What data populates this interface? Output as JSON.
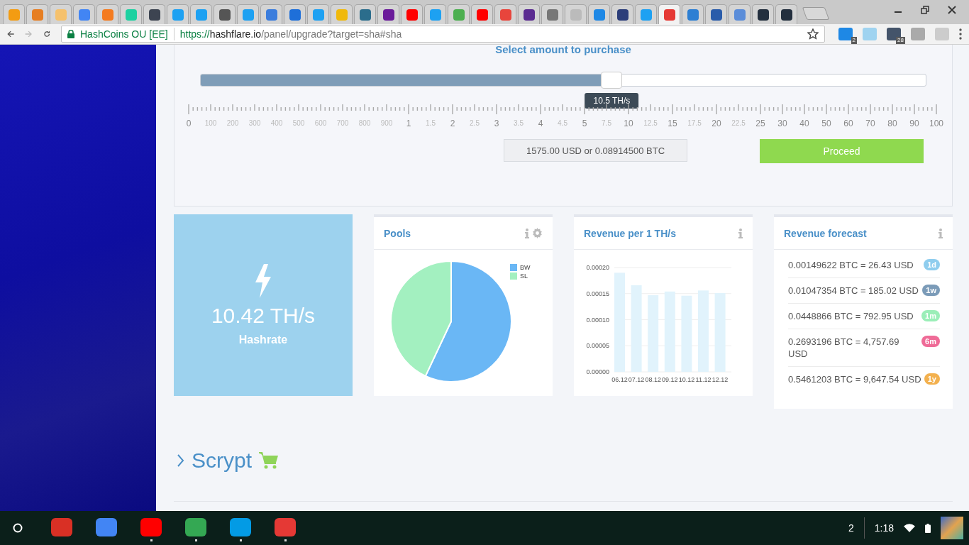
{
  "tabs": [
    {
      "color": "#f39c12",
      "selected": false
    },
    {
      "color": "#e67e22",
      "selected": false
    },
    {
      "color": "#f5c16c",
      "selected": false
    },
    {
      "color": "#4285f4",
      "selected": false
    },
    {
      "color": "#f47b20",
      "selected": false
    },
    {
      "color": "#1dd1a1",
      "selected": false
    },
    {
      "color": "#3d4451",
      "selected": false
    },
    {
      "color": "#1da1f2",
      "selected": false
    },
    {
      "color": "#1da1f2",
      "selected": false
    },
    {
      "color": "#555555",
      "selected": false
    },
    {
      "color": "#1da1f2",
      "selected": false
    },
    {
      "color": "#3b7ddd",
      "selected": false
    },
    {
      "color": "#1e6fd9",
      "selected": false
    },
    {
      "color": "#1da1f2",
      "selected": false
    },
    {
      "color": "#f0b90b",
      "selected": false
    },
    {
      "color": "#2b6d8c",
      "selected": false
    },
    {
      "color": "#6a1b9a",
      "selected": false
    },
    {
      "color": "#ff0000",
      "selected": false
    },
    {
      "color": "#1da1f2",
      "selected": false
    },
    {
      "color": "#4caf50",
      "selected": false
    },
    {
      "color": "#ff0000",
      "selected": false
    },
    {
      "color": "#e8453c",
      "selected": false
    },
    {
      "color": "#5b2c91",
      "selected": false
    },
    {
      "color": "#777777",
      "selected": false
    },
    {
      "color": "#bbbbbb",
      "selected": false
    },
    {
      "color": "#1e88e5",
      "selected": false
    },
    {
      "color": "#2c3e7a",
      "selected": false
    },
    {
      "color": "#1da1f2",
      "selected": false
    },
    {
      "color": "#e53935",
      "selected": true
    },
    {
      "color": "#2d7fd3",
      "selected": false
    },
    {
      "color": "#2a5caa",
      "selected": false
    },
    {
      "color": "#5b8dd9",
      "selected": false
    },
    {
      "color": "#232f3e",
      "selected": false
    },
    {
      "color": "#232f3e",
      "selected": false
    }
  ],
  "address_bar": {
    "site": "HashCoins OU [EE]",
    "scheme": "https://",
    "host": "hashflare.io",
    "path": "/panel/upgrade?target=sha#sha"
  },
  "extensions": [
    {
      "color": "#1e88e5",
      "badge": "2"
    },
    {
      "color": "#9fd3f0"
    },
    {
      "color": "#44546a",
      "badge": "28"
    },
    {
      "color": "#aaaaaa"
    },
    {
      "color": "#cccccc"
    }
  ],
  "purchase": {
    "heading": "Select amount to purchase",
    "slider": {
      "level": 0.567,
      "tooltip": "10.5 TH/s"
    },
    "scale": [
      {
        "label": "0",
        "major": true
      },
      {
        "label": "100",
        "major": false
      },
      {
        "label": "200",
        "major": false
      },
      {
        "label": "300",
        "major": false
      },
      {
        "label": "400",
        "major": false
      },
      {
        "label": "500",
        "major": false
      },
      {
        "label": "600",
        "major": false
      },
      {
        "label": "700",
        "major": false
      },
      {
        "label": "800",
        "major": false
      },
      {
        "label": "900",
        "major": false
      },
      {
        "label": "1",
        "major": true
      },
      {
        "label": "1.5",
        "major": false
      },
      {
        "label": "2",
        "major": true
      },
      {
        "label": "2.5",
        "major": false
      },
      {
        "label": "3",
        "major": true
      },
      {
        "label": "3.5",
        "major": false
      },
      {
        "label": "4",
        "major": true
      },
      {
        "label": "4.5",
        "major": false
      },
      {
        "label": "5",
        "major": true
      },
      {
        "label": "7.5",
        "major": false
      },
      {
        "label": "10",
        "major": true
      },
      {
        "label": "12.5",
        "major": false
      },
      {
        "label": "15",
        "major": true
      },
      {
        "label": "17.5",
        "major": false
      },
      {
        "label": "20",
        "major": true
      },
      {
        "label": "22.5",
        "major": false
      },
      {
        "label": "25",
        "major": true
      },
      {
        "label": "30",
        "major": true
      },
      {
        "label": "40",
        "major": true
      },
      {
        "label": "50",
        "major": true
      },
      {
        "label": "60",
        "major": true
      },
      {
        "label": "70",
        "major": true
      },
      {
        "label": "80",
        "major": true
      },
      {
        "label": "90",
        "major": true
      },
      {
        "label": "100",
        "major": true
      }
    ],
    "price": "1575.00 USD or 0.08914500 BTC",
    "proceed": "Proceed"
  },
  "hashrate": {
    "value": "10.42 TH/s",
    "label": "Hashrate"
  },
  "pools": {
    "title": "Pools",
    "legend": [
      {
        "label": "BW",
        "color": "#6ab7f5"
      },
      {
        "label": "SL",
        "color": "#a3f0c0"
      }
    ]
  },
  "revenue": {
    "title": "Revenue per 1 TH/s",
    "chart_data": {
      "type": "bar",
      "categories": [
        "06.12",
        "07.12",
        "08.12",
        "09.12",
        "10.12",
        "11.12",
        "12.12"
      ],
      "grid": true,
      "series": [
        {
          "color": "#e1f3fc",
          "values": [
            0.00019,
            0.000166,
            0.000147,
            0.000154,
            0.000146,
            0.000156,
            0.000151
          ]
        }
      ],
      "ylim": [
        0,
        0.0002
      ],
      "yticks": [
        {
          "value": 0,
          "label": "0.00000"
        },
        {
          "value": 5e-05,
          "label": "0.00005"
        },
        {
          "value": 0.0001,
          "label": "0.00010"
        },
        {
          "value": 0.00015,
          "label": "0.00015"
        },
        {
          "value": 0.0002,
          "label": "0.00020"
        }
      ]
    }
  },
  "forecast": {
    "title": "Revenue forecast",
    "items": [
      {
        "text": "0.00149622 BTC = 26.43 USD",
        "badge": "1d",
        "color": "#8fcdee"
      },
      {
        "text": "0.01047354 BTC = 185.02 USD",
        "badge": "1w",
        "color": "#7b9bb8"
      },
      {
        "text": "0.0448866 BTC = 792.95 USD",
        "badge": "1m",
        "color": "#9beeb8"
      },
      {
        "text": "0.2693196 BTC = 4,757.69 USD",
        "badge": "6m",
        "color": "#ef6b97"
      },
      {
        "text": "0.5461203 BTC = 9,647.54 USD",
        "badge": "1y",
        "color": "#f3b14f"
      }
    ]
  },
  "section": {
    "title": "Scrypt"
  },
  "taskbar": {
    "apps": [
      {
        "color": "#d93025",
        "running": false
      },
      {
        "color": "#4285f4",
        "running": false
      },
      {
        "color": "#ff0000",
        "running": true
      },
      {
        "color": "#34a853",
        "running": true
      },
      {
        "color": "#039be5",
        "running": true
      },
      {
        "color": "#e53935",
        "running": true
      }
    ],
    "notifications": "2",
    "time": "1:18"
  }
}
